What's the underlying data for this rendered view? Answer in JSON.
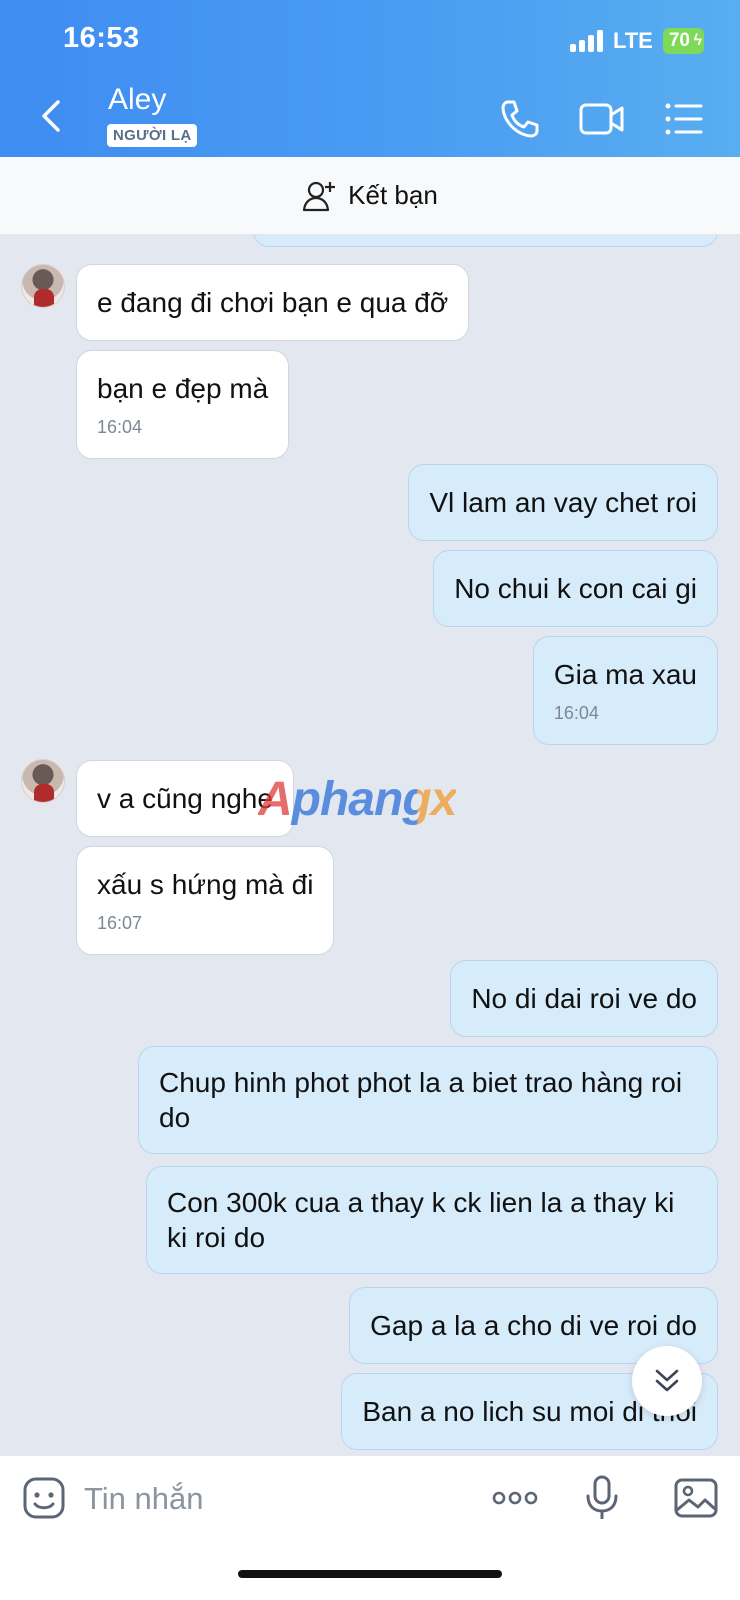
{
  "status_bar": {
    "time": "16:53",
    "network": "LTE",
    "battery": "70"
  },
  "header": {
    "title": "Aley",
    "badge": "NGƯỜI LẠ"
  },
  "friend_bar": {
    "label": "Kết bạn"
  },
  "messages": [
    {
      "dir": "in",
      "text": "e đang đi chơi bạn e qua đỡ"
    },
    {
      "dir": "in",
      "text": "bạn e đẹp mà",
      "time": "16:04"
    },
    {
      "dir": "out",
      "text": "Vl lam an vay chet roi"
    },
    {
      "dir": "out",
      "text": "No chui k con cai gi"
    },
    {
      "dir": "out",
      "text": "Gia ma xau",
      "time": "16:04"
    },
    {
      "dir": "in",
      "text": "v a cũng nghe"
    },
    {
      "dir": "in",
      "text": "xấu s hứng mà đi",
      "time": "16:07"
    },
    {
      "dir": "out",
      "text": "No di dai roi ve do"
    },
    {
      "dir": "out",
      "text": "Chup hinh phot phot la a biet trao hàng roi do"
    },
    {
      "dir": "out",
      "text": "Con 300k cua a thay k ck lien la a thay ki ki roi do"
    },
    {
      "dir": "out",
      "text": "Gap a la a cho di ve roi do"
    },
    {
      "dir": "out",
      "text": "Ban a no lich su moi di thoi"
    }
  ],
  "watermark": "Aphangx",
  "input": {
    "placeholder": "Tin nhắn"
  },
  "colors": {
    "header_start": "#3f8cf2",
    "header_end": "#58aef0",
    "outgoing_bubble": "#d7ecfb",
    "incoming_bubble": "#ffffff",
    "battery": "#7dd957"
  },
  "icons": [
    "back-icon",
    "phone-icon",
    "video-call-icon",
    "menu-list-icon",
    "add-friend-icon",
    "sticker-icon",
    "more-icon",
    "microphone-icon",
    "image-icon",
    "scroll-down-icon"
  ]
}
